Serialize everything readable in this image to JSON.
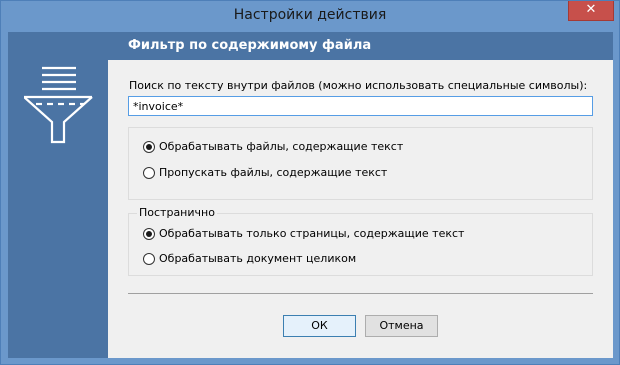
{
  "window": {
    "title": "Настройки действия",
    "close_glyph": "✕"
  },
  "header": {
    "title": "Фильтр по содержимому файла",
    "icon": "funnel-filter-icon"
  },
  "search": {
    "label": "Поиск по тексту внутри файлов (можно использовать специальные символы):",
    "value": "*invoice*"
  },
  "file_mode": {
    "options": [
      {
        "label": "Обрабатывать файлы, содержащие текст",
        "checked": true
      },
      {
        "label": "Пропускать файлы, содержащие текст",
        "checked": false
      }
    ]
  },
  "page_mode": {
    "title": "Постранично",
    "options": [
      {
        "label": "Обрабатывать только страницы, содержащие текст",
        "checked": true
      },
      {
        "label": "Обрабатывать документ целиком",
        "checked": false
      }
    ]
  },
  "buttons": {
    "ok": "ОК",
    "cancel": "Отмена"
  },
  "colors": {
    "frame": "#6b98cb",
    "panel": "#4b74a4",
    "content_bg": "#f0f0f0",
    "close_button": "#c7504b"
  }
}
